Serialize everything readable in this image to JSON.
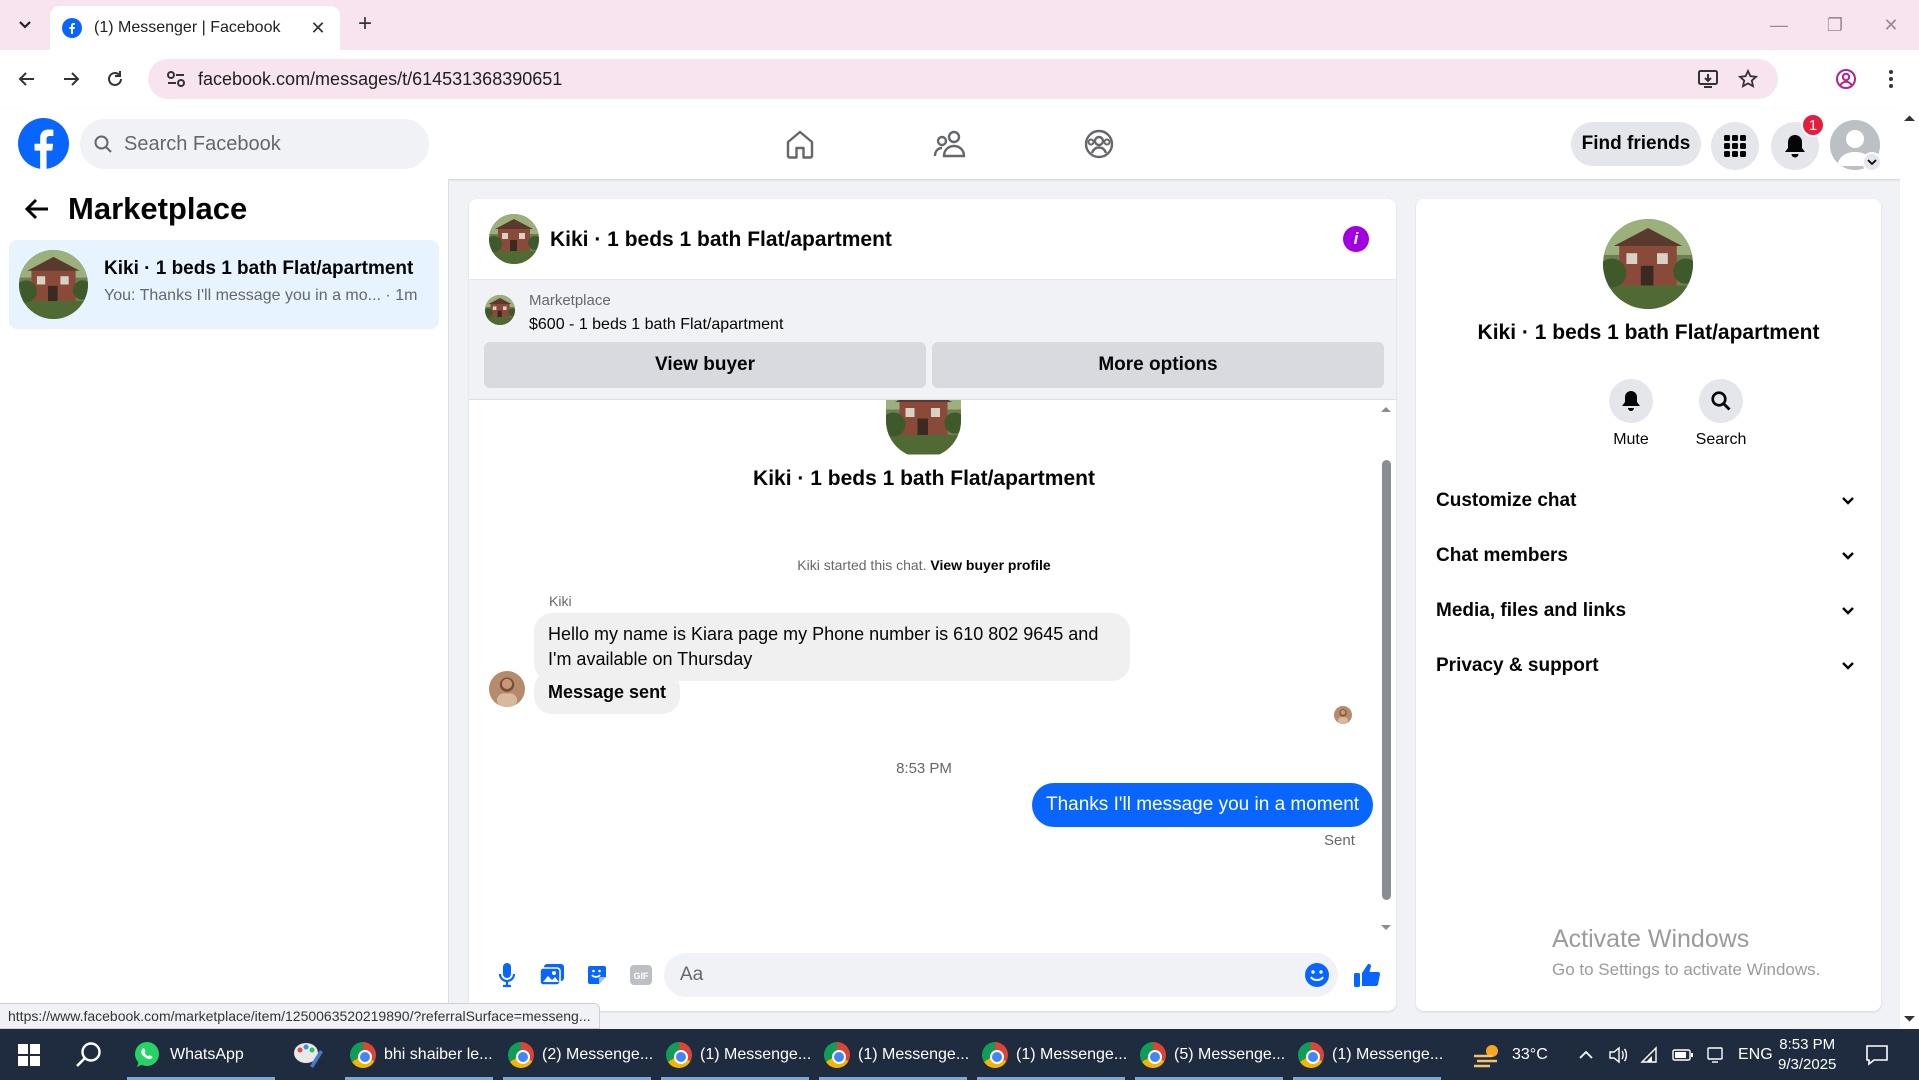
{
  "browser": {
    "tab_title": "(1) Messenger | Facebook",
    "url": "facebook.com/messages/t/614531368390651",
    "status_url": "https://www.facebook.com/marketplace/item/1250063520219890/?referralSurface=messeng..."
  },
  "header": {
    "search_placeholder": "Search Facebook",
    "find_friends": "Find friends",
    "notification_count": "1"
  },
  "sidebar": {
    "title": "Marketplace",
    "conversation": {
      "name": "Kiki · 1 beds 1 bath Flat/apartment",
      "snippet": "You: Thanks I'll message you in a mo... · 1m"
    }
  },
  "chat": {
    "title": "Kiki · 1 beds 1 bath Flat/apartment",
    "banner": {
      "label": "Marketplace",
      "price_line": "$600 - 1 beds 1 bath Flat/apartment",
      "view_buyer": "View buyer",
      "more_options": "More options"
    },
    "thread_title": "Kiki · 1 beds 1 bath Flat/apartment",
    "started_text": "Kiki started this chat.",
    "view_profile": "View buyer profile",
    "sender": "Kiki",
    "msg1": "Hello my name is Kiara page my Phone number is 610 802 9645 and I'm available on Thursday",
    "msg2": "Message sent",
    "timestamp": "8:53 PM",
    "out_msg": "Thanks I'll message you in a moment",
    "sent_label": "Sent",
    "composer_placeholder": "Aa"
  },
  "details": {
    "title": "Kiki · 1 beds 1 bath Flat/apartment",
    "mute": "Mute",
    "search": "Search",
    "sections": [
      "Customize chat",
      "Chat members",
      "Media, files and links",
      "Privacy & support"
    ]
  },
  "watermark": {
    "line1": "Activate Windows",
    "line2": "Go to Settings to activate Windows."
  },
  "taskbar": {
    "whatsapp": "WhatsApp",
    "items": [
      "bhi shaiber le...",
      "(2) Messenge...",
      "(1) Messenge...",
      "(1) Messenge...",
      "(1) Messenge...",
      "(5) Messenge...",
      "(1) Messenge..."
    ],
    "temperature": "33°C",
    "language": "ENG",
    "time": "8:53 PM",
    "date": "9/3/2025"
  },
  "colors": {
    "facebook_blue": "#0866ff",
    "info_purple": "#a200e1",
    "badge_red": "#e41e3f",
    "active_conversation": "#e7f3ff"
  }
}
